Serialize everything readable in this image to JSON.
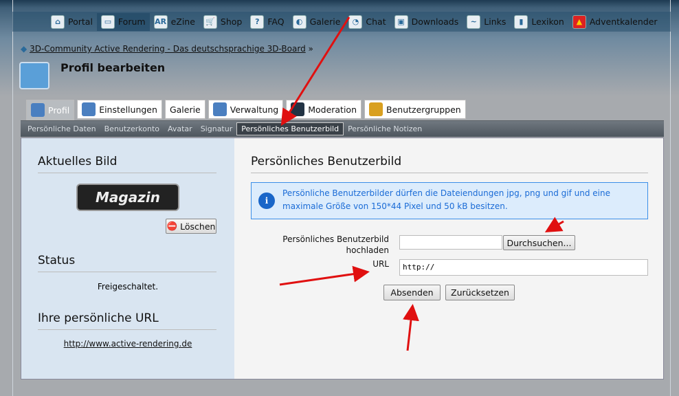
{
  "topnav": [
    "Portal",
    "Forum",
    "eZine",
    "Shop",
    "FAQ",
    "Galerie",
    "Chat",
    "Downloads",
    "Links",
    "Lexikon",
    "Adventkalender"
  ],
  "breadcrumb": "3D-Community Active Rendering - Das deutschsprachige 3D-Board",
  "breadcrumb_sep": "»",
  "page_title": "Profil bearbeiten",
  "tabs": [
    "Profil",
    "Einstellungen",
    "Galerie",
    "Verwaltung",
    "Moderation",
    "Benutzergruppen"
  ],
  "subnav": [
    "Persönliche Daten",
    "Benutzerkonto",
    "Avatar",
    "Signatur",
    "Persönliches Benutzerbild",
    "Persönliche Notizen"
  ],
  "left": {
    "current_title": "Aktuelles Bild",
    "logo_text": "Magazin",
    "delete": "Löschen",
    "status_title": "Status",
    "status": "Freigeschaltet.",
    "url_title": "Ihre persönliche URL",
    "url": "http://www.active-rendering.de"
  },
  "right": {
    "title": "Persönliches Benutzerbild",
    "info": "Persönliche Benutzerbilder dürfen die Dateiendungen jpg, png und gif und eine maximale Größe von 150*44 Pixel und 50 kB besitzen.",
    "upload_label": "Persönliches Benutzerbild hochladen",
    "browse": "Durchsuchen...",
    "url_label": "URL",
    "url_value": "http://",
    "submit": "Absenden",
    "reset": "Zurücksetzen"
  }
}
